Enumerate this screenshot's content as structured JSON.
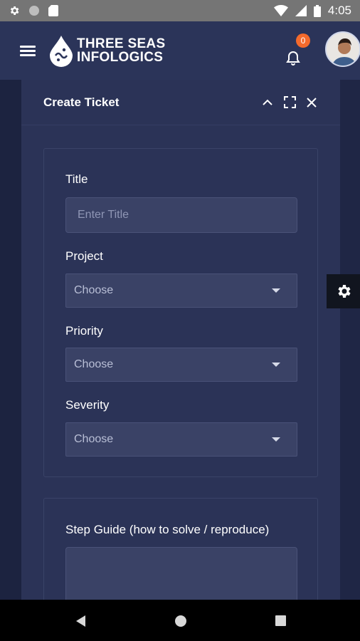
{
  "status_bar": {
    "time": "4:05",
    "left_icons": [
      "settings-icon",
      "circle-icon",
      "sd-card-icon"
    ],
    "right_icons": [
      "wifi-icon",
      "signal-icon",
      "battery-icon"
    ]
  },
  "header": {
    "brand_line1": "THREE SEAS",
    "brand_line2": "INFOLOGICS",
    "notification_count": "0"
  },
  "panel": {
    "title": "Create Ticket"
  },
  "form": {
    "title_label": "Title",
    "title_placeholder": "Enter Title",
    "title_value": "",
    "project_label": "Project",
    "project_value": "Choose",
    "priority_label": "Priority",
    "priority_value": "Choose",
    "severity_label": "Severity",
    "severity_value": "Choose",
    "step_guide_label": "Step Guide (how to solve / reproduce)"
  },
  "colors": {
    "accent_badge": "#f46a2c",
    "header_bg": "#2b3459",
    "panel_bg": "#2b3357"
  }
}
